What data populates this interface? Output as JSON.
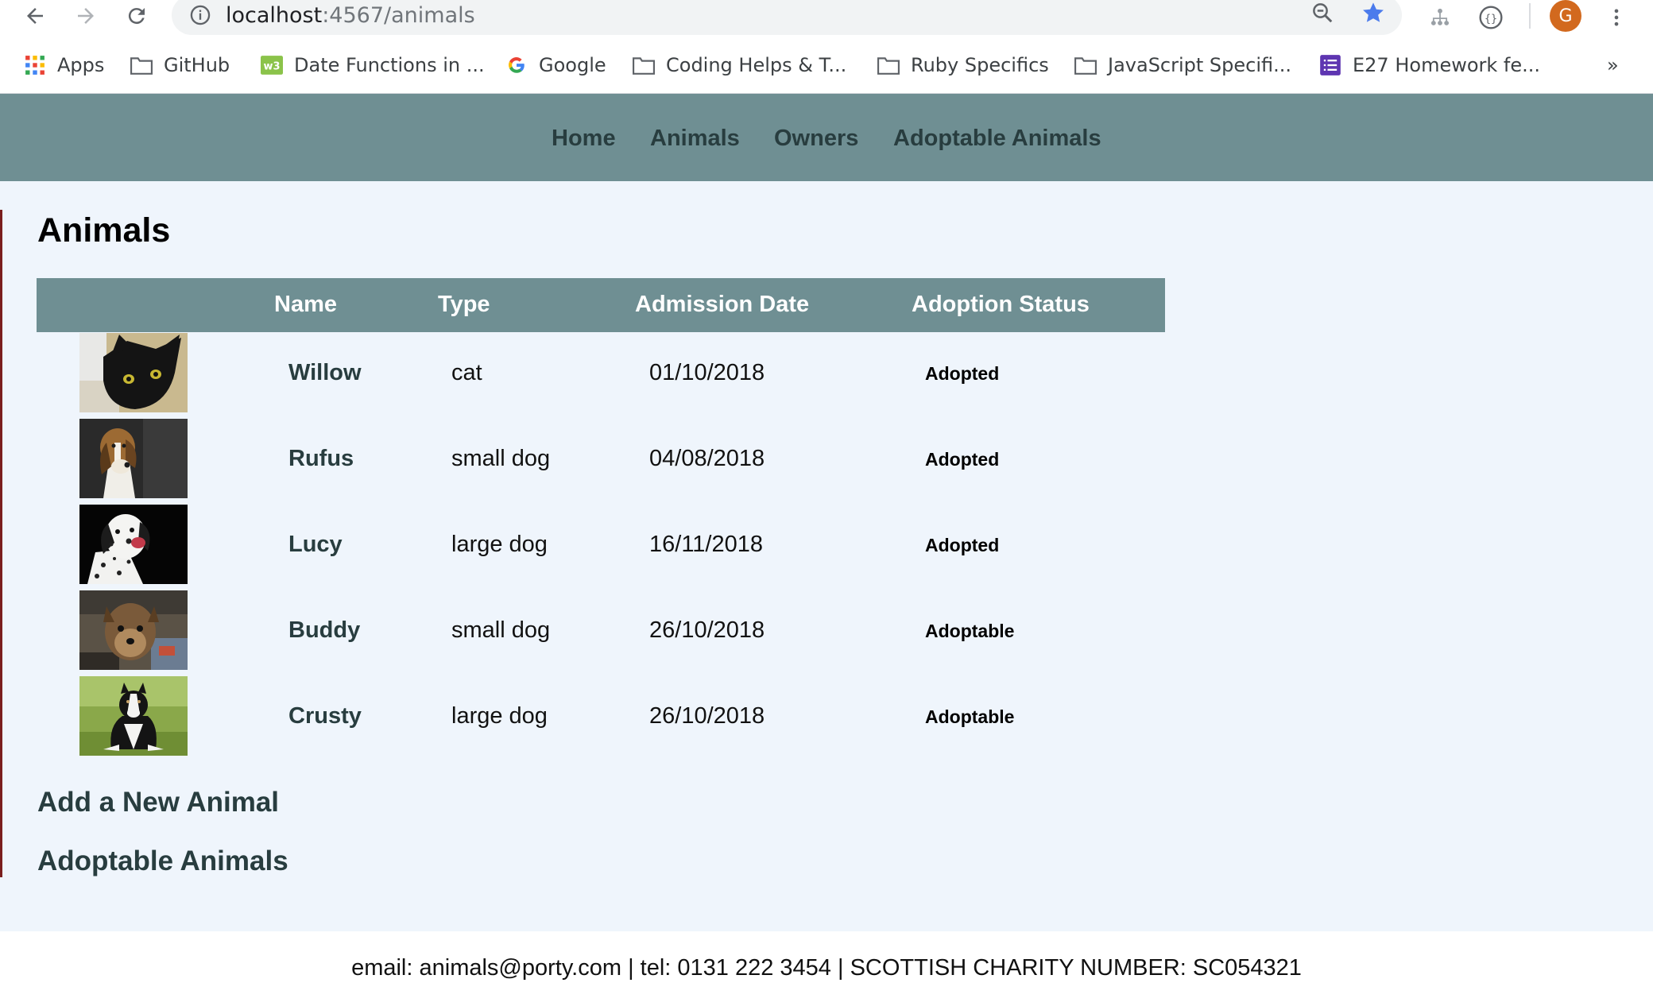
{
  "browser": {
    "url_host": "localhost",
    "url_rest": ":4567/animals",
    "avatar_letter": "G",
    "bookmarks": [
      {
        "label": "Apps",
        "icon": "apps-grid-icon"
      },
      {
        "label": "GitHub",
        "icon": "folder-icon"
      },
      {
        "label": "Date Functions in ...",
        "icon": "w3-icon"
      },
      {
        "label": "Google",
        "icon": "google-icon"
      },
      {
        "label": "Coding Helps & T...",
        "icon": "folder-icon"
      },
      {
        "label": "Ruby Specifics",
        "icon": "folder-icon"
      },
      {
        "label": "JavaScript Specifi...",
        "icon": "folder-icon"
      },
      {
        "label": "E27 Homework fe...",
        "icon": "list-icon"
      }
    ],
    "overflow": "»"
  },
  "nav": {
    "items": [
      "Home",
      "Animals",
      "Owners",
      "Adoptable Animals"
    ]
  },
  "page": {
    "title": "Animals",
    "columns": [
      "Name",
      "Type",
      "Admission Date",
      "Adoption Status"
    ],
    "rows": [
      {
        "name": "Willow",
        "type": "cat",
        "date": "01/10/2018",
        "status": "Adopted",
        "photo": "black-cat"
      },
      {
        "name": "Rufus",
        "type": "small dog",
        "date": "04/08/2018",
        "status": "Adopted",
        "photo": "beagle"
      },
      {
        "name": "Lucy",
        "type": "large dog",
        "date": "16/11/2018",
        "status": "Adopted",
        "photo": "dalmatian"
      },
      {
        "name": "Buddy",
        "type": "small dog",
        "date": "26/10/2018",
        "status": "Adoptable",
        "photo": "yorkshire-terrier"
      },
      {
        "name": "Crusty",
        "type": "large dog",
        "date": "26/10/2018",
        "status": "Adoptable",
        "photo": "border-collie"
      }
    ],
    "add_link": "Add a New Animal",
    "adoptable_link": "Adoptable Animals"
  },
  "footer": {
    "text": "email: animals@porty.com | tel: 0131 222 3454 | SCOTTISH CHARITY NUMBER: SC054321"
  },
  "colors": {
    "nav_bg": "#6f8f93",
    "page_bg": "#eff5fc",
    "link": "#283d3f",
    "star": "#4b7bec",
    "avatar": "#d2691e"
  }
}
